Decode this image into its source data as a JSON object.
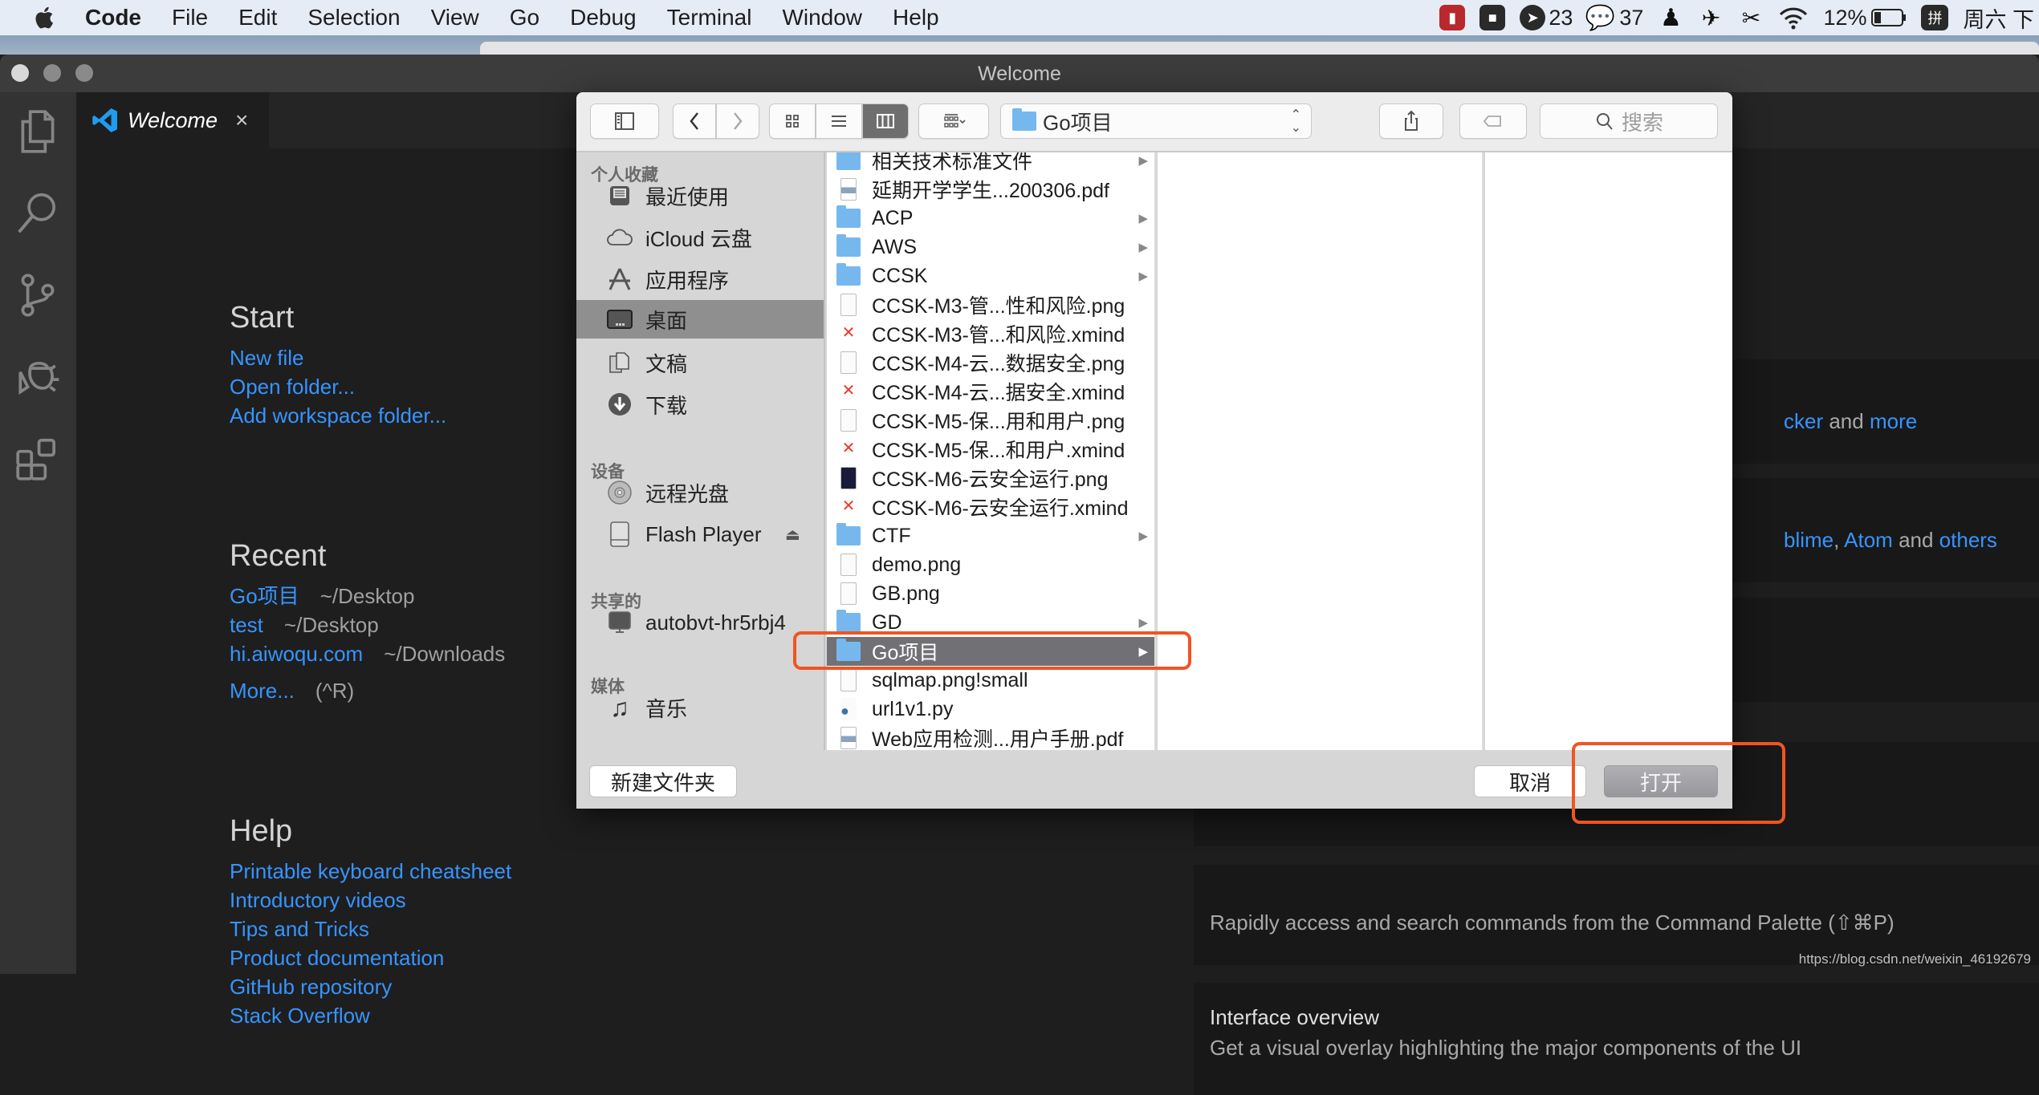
{
  "menubar": {
    "app": "Code",
    "items": [
      "File",
      "Edit",
      "Selection",
      "View",
      "Go",
      "Debug",
      "Terminal",
      "Window",
      "Help"
    ],
    "status": {
      "notification_count": "23",
      "wechat_count": "37",
      "battery": "12%",
      "input_method": "拼",
      "clock": "周六 下"
    }
  },
  "window": {
    "title": "Welcome",
    "tab": {
      "label": "Welcome",
      "close": "×"
    }
  },
  "welcome": {
    "start": {
      "heading": "Start",
      "links": [
        "New file",
        "Open folder...",
        "Add workspace folder..."
      ]
    },
    "recent": {
      "heading": "Recent",
      "items": [
        {
          "name": "Go项目",
          "path": "~/Desktop"
        },
        {
          "name": "test",
          "path": "~/Desktop"
        },
        {
          "name": "hi.aiwoqu.com",
          "path": "~/Downloads"
        }
      ],
      "more": "More...",
      "more_shortcut": "(^R)"
    },
    "help": {
      "heading": "Help",
      "links": [
        "Printable keyboard cheatsheet",
        "Introductory videos",
        "Tips and Tricks",
        "Product documentation",
        "GitHub repository",
        "Stack Overflow"
      ]
    },
    "right_panel": {
      "tools_line": {
        "link1": "cker",
        "and": " and ",
        "link2": "more"
      },
      "keymaps_line": {
        "link1": "blime",
        "sep": ", ",
        "link2": "Atom",
        "and": " and ",
        "link3": "others"
      },
      "command_palette_desc": "Rapidly access and search commands from the Command Palette (⇧⌘P)",
      "interface_title": "Interface overview",
      "interface_desc": "Get a visual overlay highlighting the major components of the UI"
    },
    "watermark": "https://blog.csdn.net/weixin_46192679"
  },
  "dialog": {
    "location": "Go项目",
    "search_placeholder": "搜索",
    "sidebar": {
      "favorites_heading": "个人收藏",
      "favorites": [
        {
          "label": "最近使用",
          "icon": "recents-icon"
        },
        {
          "label": "iCloud 云盘",
          "icon": "cloud-icon"
        },
        {
          "label": "应用程序",
          "icon": "applications-icon"
        },
        {
          "label": "桌面",
          "icon": "desktop-icon",
          "selected": true
        },
        {
          "label": "文稿",
          "icon": "documents-icon"
        },
        {
          "label": "下载",
          "icon": "downloads-icon"
        }
      ],
      "devices_heading": "设备",
      "devices": [
        {
          "label": "远程光盘",
          "icon": "disc-icon"
        },
        {
          "label": "Flash Player",
          "icon": "drive-icon",
          "eject": "⏏"
        }
      ],
      "shared_heading": "共享的",
      "shared": [
        {
          "label": "autobvt-hr5rbj4",
          "icon": "computer-icon"
        }
      ],
      "media_heading": "媒体",
      "media": [
        {
          "label": "音乐",
          "icon": "music-icon"
        }
      ]
    },
    "files": [
      {
        "name": "相关技术标准文件",
        "type": "folder"
      },
      {
        "name": "延期开学学生...200306.pdf",
        "type": "pdf"
      },
      {
        "name": "ACP",
        "type": "folder"
      },
      {
        "name": "AWS",
        "type": "folder"
      },
      {
        "name": "CCSK",
        "type": "folder"
      },
      {
        "name": "CCSK-M3-管...性和风险.png",
        "type": "image"
      },
      {
        "name": "CCSK-M3-管...和风险.xmind",
        "type": "xmind"
      },
      {
        "name": "CCSK-M4-云...数据安全.png",
        "type": "image"
      },
      {
        "name": "CCSK-M4-云...据安全.xmind",
        "type": "xmind"
      },
      {
        "name": "CCSK-M5-保...用和用户.png",
        "type": "image"
      },
      {
        "name": "CCSK-M5-保...和用户.xmind",
        "type": "xmind"
      },
      {
        "name": "CCSK-M6-云安全运行.png",
        "type": "image-dark"
      },
      {
        "name": "CCSK-M6-云安全运行.xmind",
        "type": "xmind"
      },
      {
        "name": "CTF",
        "type": "folder"
      },
      {
        "name": "demo.png",
        "type": "image"
      },
      {
        "name": "GB.png",
        "type": "image"
      },
      {
        "name": "GD",
        "type": "folder"
      },
      {
        "name": "Go项目",
        "type": "folder",
        "selected": true
      },
      {
        "name": "sqlmap.png!small",
        "type": "file"
      },
      {
        "name": "url1v1.py",
        "type": "python"
      },
      {
        "name": "Web应用检测...用户手册.pdf",
        "type": "pdf"
      }
    ],
    "buttons": {
      "new_folder": "新建文件夹",
      "cancel": "取消",
      "open": "打开"
    }
  },
  "colors": {
    "link": "#3794ff",
    "highlight": "#ef5523",
    "selected_row": "#717175",
    "folder": "#76b8ee"
  }
}
